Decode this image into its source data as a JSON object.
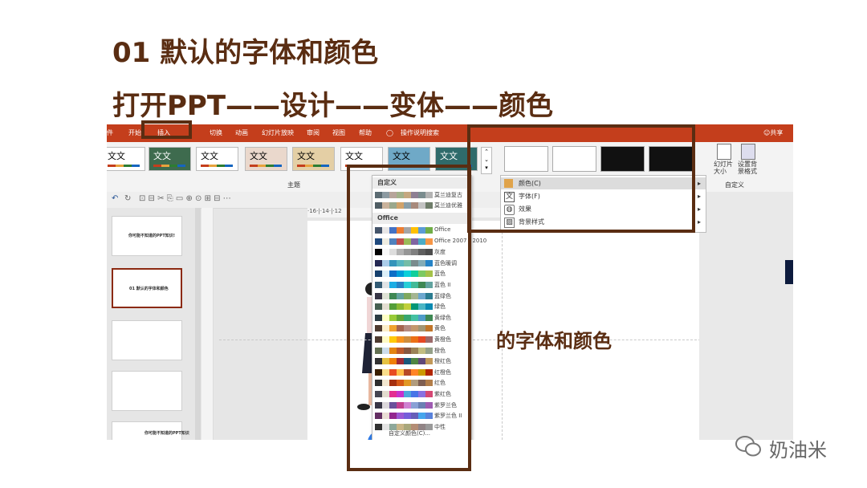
{
  "page": {
    "heading1": "01 默认的字体和颜色",
    "heading2": "打开PPT——设计——变体——颜色"
  },
  "window": {
    "tabs": [
      "开始",
      "插入",
      "切换",
      "动画",
      "幻灯片放映",
      "审阅",
      "视图",
      "帮助",
      "操作说明搜索"
    ],
    "share": "共享",
    "accent_color": "#c43e1c"
  },
  "ribbon": {
    "theme_sample_text": "文文",
    "themes_group_label": "主题",
    "slide_size_label": "幻灯片 大小",
    "format_bg_label": "设置背 景格式",
    "customize_group_label": "自定义"
  },
  "thumbnails": [
    {
      "title": "你可能不知道的PPT知识!"
    },
    {
      "title": "01 默认的字体和颜色"
    },
    {
      "title": ""
    },
    {
      "title": ""
    },
    {
      "title": "你可能不知道的PPT知识"
    }
  ],
  "slide": {
    "title_fragment": "的字体和颜色"
  },
  "ruler": {
    "marks": "·16·|·14·|·12"
  },
  "color_menu": {
    "custom_header": "自定义",
    "custom_items": [
      "莫兰迪复古",
      "莫兰迪优雅"
    ],
    "office_header": "Office",
    "items": [
      "Office",
      "Office 2007 - 2010",
      "灰度",
      "蓝色暖调",
      "蓝色",
      "蓝色 II",
      "蓝绿色",
      "绿色",
      "黄绿色",
      "黄色",
      "黄橙色",
      "橙色",
      "橙红色",
      "红橙色",
      "红色",
      "紫红色",
      "紫罗兰色",
      "紫罗兰色 II",
      "中性"
    ],
    "footer": "自定义颜色(C)..."
  },
  "variant_menu": {
    "items": [
      {
        "label": "颜色(C)",
        "icon": "palette-icon"
      },
      {
        "label": "字体(F)",
        "icon": "font-icon"
      },
      {
        "label": "效果",
        "icon": "effects-icon"
      },
      {
        "label": "背景样式",
        "icon": "background-icon"
      }
    ]
  },
  "watermark": {
    "text": "奶油米"
  }
}
